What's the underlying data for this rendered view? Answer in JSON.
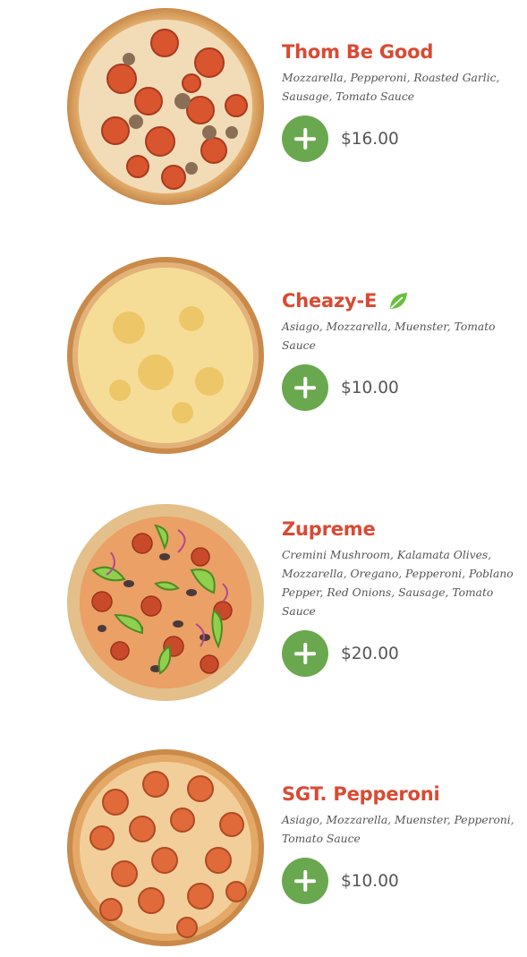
{
  "items": [
    {
      "name": "Thom Be Good",
      "ingredients": "Mozzarella, Pepperoni, Roasted Garlic, Sausage, Tomato Sauce",
      "price": "$16.00",
      "vegetarian": false
    },
    {
      "name": "Cheazy-E",
      "ingredients": "Asiago, Mozzarella, Muenster, Tomato Sauce",
      "price": "$10.00",
      "vegetarian": true
    },
    {
      "name": "Zupreme",
      "ingredients": "Cremini Mushroom, Kalamata Olives, Mozzarella, Oregano, Pepperoni, Poblano Pepper, Red Onions, Sausage, Tomato Sauce",
      "price": "$20.00",
      "vegetarian": false
    },
    {
      "name": "SGT. Pepperoni",
      "ingredients": "Asiago, Mozzarella, Muenster, Pepperoni, Tomato Sauce",
      "price": "$10.00",
      "vegetarian": false
    }
  ],
  "colors": {
    "accent": "#d94a33",
    "add_button": "#6aa84f",
    "veg_leaf": "#6abf3f"
  },
  "icons": {
    "add": "plus-icon",
    "vegetarian": "leaf-icon"
  }
}
